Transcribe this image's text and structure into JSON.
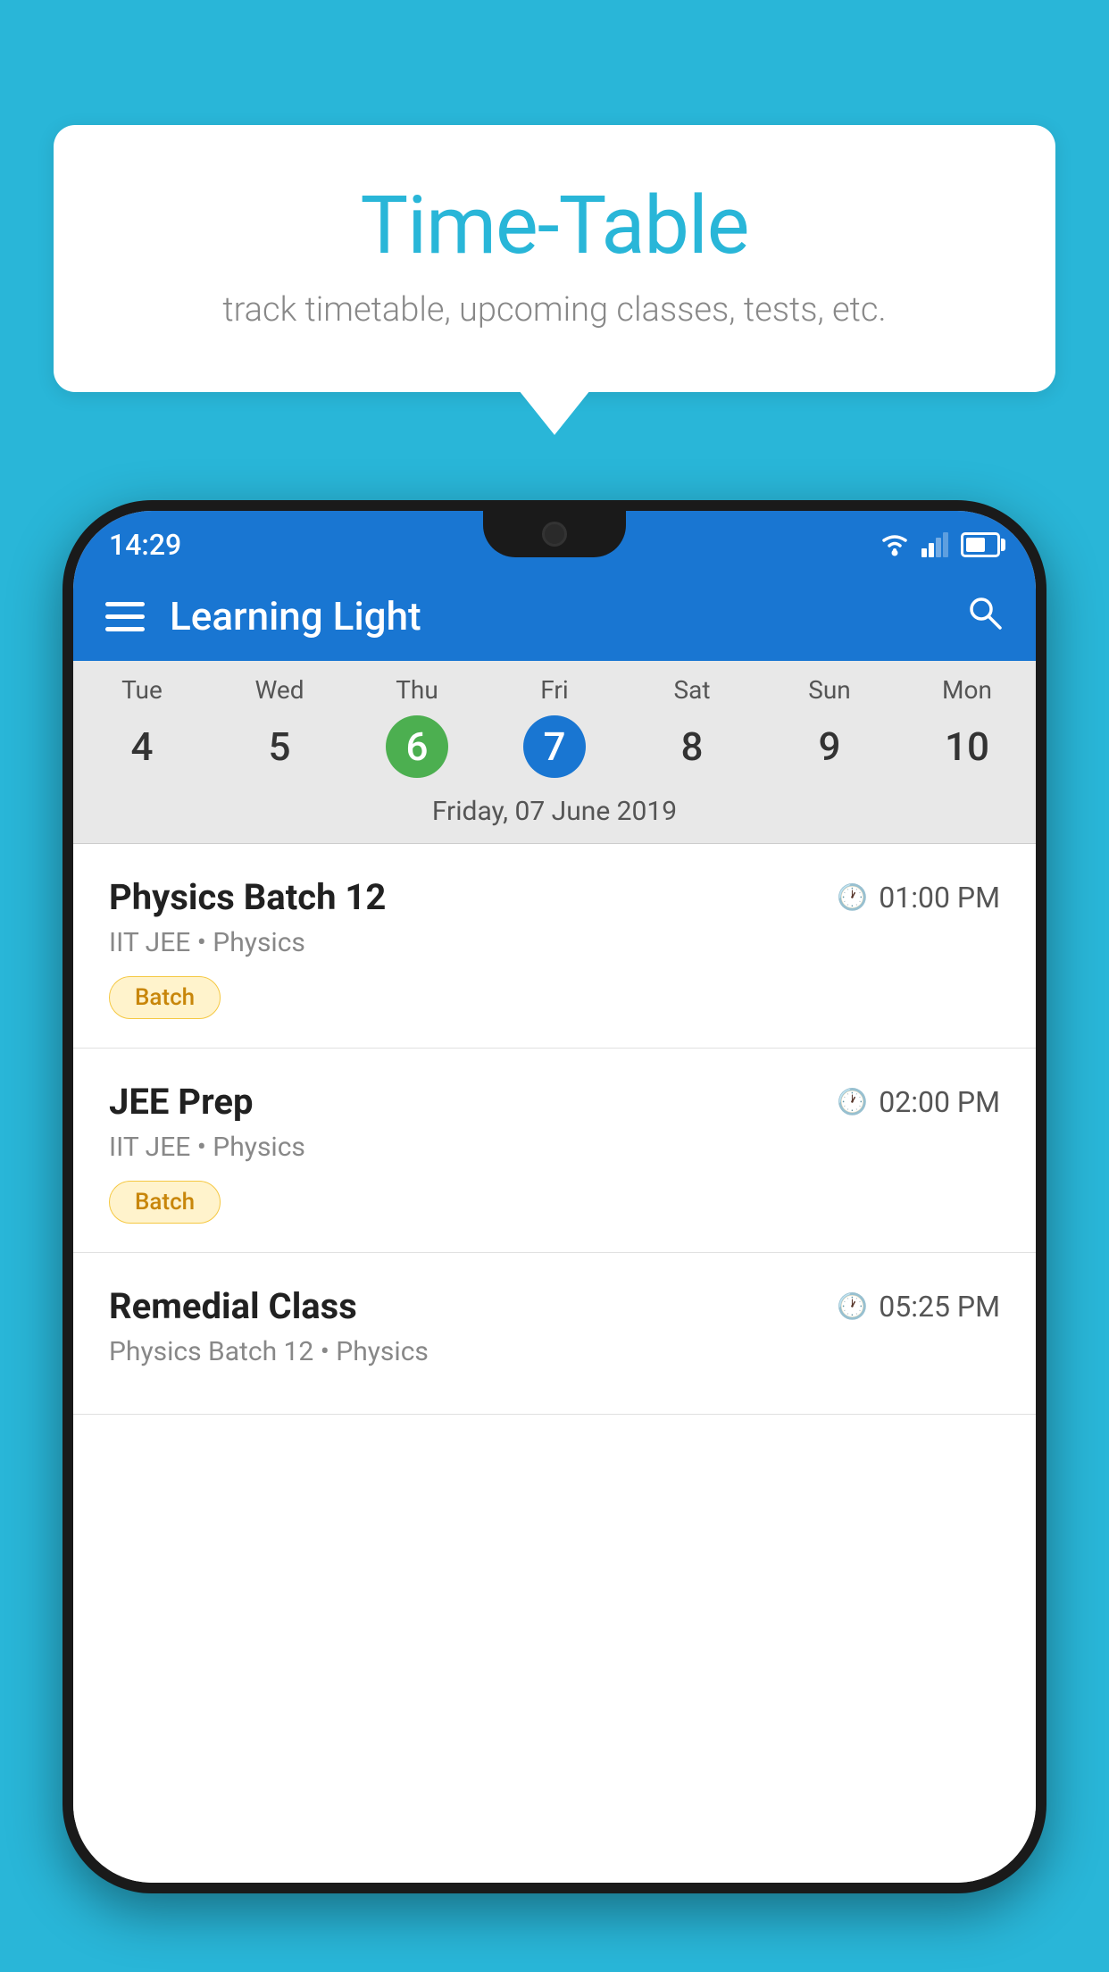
{
  "background_color": "#29B6D8",
  "speech_bubble": {
    "title": "Time-Table",
    "subtitle": "track timetable, upcoming classes, tests, etc."
  },
  "phone": {
    "status_bar": {
      "time": "14:29"
    },
    "app_bar": {
      "title": "Learning Light",
      "hamburger_label": "menu",
      "search_label": "search"
    },
    "calendar": {
      "days": [
        {
          "name": "Tue",
          "num": "4",
          "state": "normal"
        },
        {
          "name": "Wed",
          "num": "5",
          "state": "normal"
        },
        {
          "name": "Thu",
          "num": "6",
          "state": "today"
        },
        {
          "name": "Fri",
          "num": "7",
          "state": "selected"
        },
        {
          "name": "Sat",
          "num": "8",
          "state": "normal"
        },
        {
          "name": "Sun",
          "num": "9",
          "state": "normal"
        },
        {
          "name": "Mon",
          "num": "10",
          "state": "normal"
        }
      ],
      "selected_date_label": "Friday, 07 June 2019"
    },
    "schedule": [
      {
        "title": "Physics Batch 12",
        "time": "01:00 PM",
        "subtitle": "IIT JEE • Physics",
        "badge": "Batch"
      },
      {
        "title": "JEE Prep",
        "time": "02:00 PM",
        "subtitle": "IIT JEE • Physics",
        "badge": "Batch"
      },
      {
        "title": "Remedial Class",
        "time": "05:25 PM",
        "subtitle": "Physics Batch 12 • Physics",
        "badge": null
      }
    ]
  }
}
